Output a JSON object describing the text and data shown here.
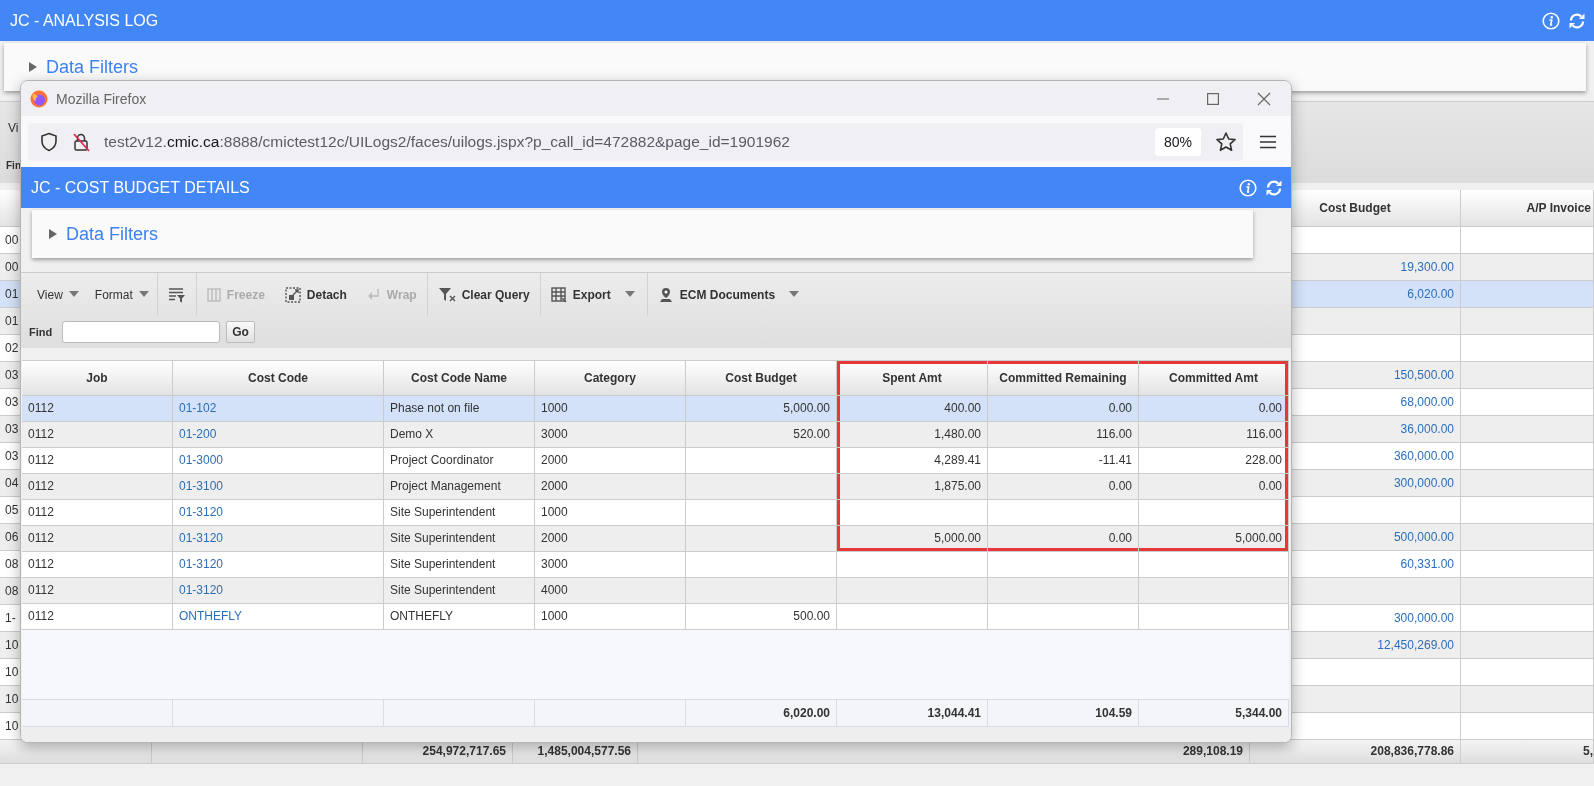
{
  "app": {
    "title": "JC - ANALYSIS LOG",
    "filters": {
      "label": "Data Filters",
      "expanded": false
    },
    "toolbar_fragments": [
      "Vi",
      "Fin"
    ]
  },
  "background_table": {
    "columns": [
      {
        "label": "Cost Budget"
      },
      {
        "label": "A/P Invoice"
      }
    ],
    "rows": [
      {
        "column_1": "00",
        "selected": false
      },
      {
        "column_1": "00",
        "cost_budget": "19,300.00",
        "selected": false
      },
      {
        "column_1": "01",
        "cost_budget": "6,020.00",
        "selected": true
      },
      {
        "column_1": "01",
        "selected": false
      },
      {
        "column_1": "02",
        "selected": false
      },
      {
        "column_1": "03",
        "cost_budget": "150,500.00",
        "selected": false
      },
      {
        "column_1": "03",
        "cost_budget": "68,000.00",
        "selected": false
      },
      {
        "column_1": "03",
        "cost_budget": "36,000.00",
        "selected": false
      },
      {
        "column_1": "03",
        "cost_budget": "360,000.00",
        "selected": false
      },
      {
        "column_1": "04",
        "cost_budget": "300,000.00",
        "selected": false
      },
      {
        "column_1": "05",
        "selected": false
      },
      {
        "column_1": "06",
        "cost_budget": "500,000.00",
        "selected": false
      },
      {
        "column_1": "08",
        "cost_budget": "60,331.00",
        "selected": false
      },
      {
        "column_1": "08",
        "selected": false
      },
      {
        "column_1": "1-",
        "cost_budget": "300,000.00",
        "selected": false
      },
      {
        "column_1": "10",
        "cost_budget": "12,450,269.00",
        "selected": false
      },
      {
        "column_1": "10",
        "selected": false
      },
      {
        "column_1": "10",
        "selected": false
      },
      {
        "column_1": "10",
        "selected": false
      }
    ],
    "totals": [
      "254,972,717.65",
      "1,485,004,577.56",
      "289,108.19",
      "208,836,778.86",
      "5,"
    ]
  },
  "browser": {
    "title": "Mozilla Firefox",
    "url": {
      "subdomain": "test2v12.",
      "domain": "cmic.ca",
      "path": ":8888/cmictest12c/UILogs2/faces/uilogs.jspx?p_call_id=472882&page_id=1901962"
    },
    "zoom": "80%"
  },
  "page": {
    "title": "JC - COST BUDGET DETAILS",
    "filters": {
      "label": "Data Filters",
      "expanded": false
    },
    "toolbar": [
      {
        "kind": "menu",
        "label": "View"
      },
      {
        "kind": "menu",
        "label": "Format"
      },
      {
        "kind": "icon",
        "disabled": false
      },
      {
        "kind": "button",
        "label": "Freeze",
        "disabled": true
      },
      {
        "kind": "button",
        "label": "Detach",
        "disabled": false
      },
      {
        "kind": "button",
        "label": "Wrap",
        "disabled": true
      },
      {
        "kind": "button",
        "label": "Clear Query",
        "disabled": false
      },
      {
        "kind": "split",
        "label": "Export",
        "disabled": false
      },
      {
        "kind": "split",
        "label": "ECM Documents",
        "disabled": false
      }
    ],
    "find": {
      "label": "Find",
      "button": "Go"
    },
    "table": {
      "columns": [
        {
          "label": "Job",
          "kind": "text"
        },
        {
          "label": "Cost Code",
          "kind": "link"
        },
        {
          "label": "Cost Code Name",
          "kind": "text"
        },
        {
          "label": "Category",
          "kind": "text"
        },
        {
          "label": "Cost Budget",
          "kind": "number",
          "total": "6,020.00"
        },
        {
          "label": "Spent Amt",
          "kind": "number",
          "total": "13,044.41"
        },
        {
          "label": "Committed Remaining",
          "kind": "number",
          "total": "104.59"
        },
        {
          "label": "Committed Amt",
          "kind": "number",
          "total": "5,344.00"
        }
      ],
      "rows": [
        {
          "selected": true,
          "job": "0112",
          "cost_code": "01-102",
          "cost_code_name": "Phase not on file",
          "category": "1000",
          "cost_budget": "5,000.00",
          "spent_amt": "400.00",
          "committed_remaining": "0.00",
          "committed_amt": "0.00"
        },
        {
          "selected": false,
          "job": "0112",
          "cost_code": "01-200",
          "cost_code_name": "Demo X",
          "category": "3000",
          "cost_budget": "520.00",
          "spent_amt": "1,480.00",
          "committed_remaining": "116.00",
          "committed_amt": "116.00"
        },
        {
          "selected": false,
          "job": "0112",
          "cost_code": "01-3000",
          "cost_code_name": "Project Coordinator",
          "category": "2000",
          "spent_amt": "4,289.41",
          "committed_remaining": "-11.41",
          "committed_amt": "228.00"
        },
        {
          "selected": false,
          "job": "0112",
          "cost_code": "01-3100",
          "cost_code_name": "Project Management",
          "category": "2000",
          "spent_amt": "1,875.00",
          "committed_remaining": "0.00",
          "committed_amt": "0.00"
        },
        {
          "selected": false,
          "job": "0112",
          "cost_code": "01-3120",
          "cost_code_name": "Site Superintendent",
          "category": "1000"
        },
        {
          "selected": false,
          "job": "0112",
          "cost_code": "01-3120",
          "cost_code_name": "Site Superintendent",
          "category": "2000",
          "spent_amt": "5,000.00",
          "committed_remaining": "0.00",
          "committed_amt": "5,000.00"
        },
        {
          "selected": false,
          "job": "0112",
          "cost_code": "01-3120",
          "cost_code_name": "Site Superintendent",
          "category": "3000"
        },
        {
          "selected": false,
          "job": "0112",
          "cost_code": "01-3120",
          "cost_code_name": "Site Superintendent",
          "category": "4000"
        },
        {
          "selected": false,
          "job": "0112",
          "cost_code": "ONTHEFLY",
          "cost_code_name": "ONTHEFLY",
          "category": "1000",
          "cost_budget": "500.00"
        }
      ]
    }
  }
}
